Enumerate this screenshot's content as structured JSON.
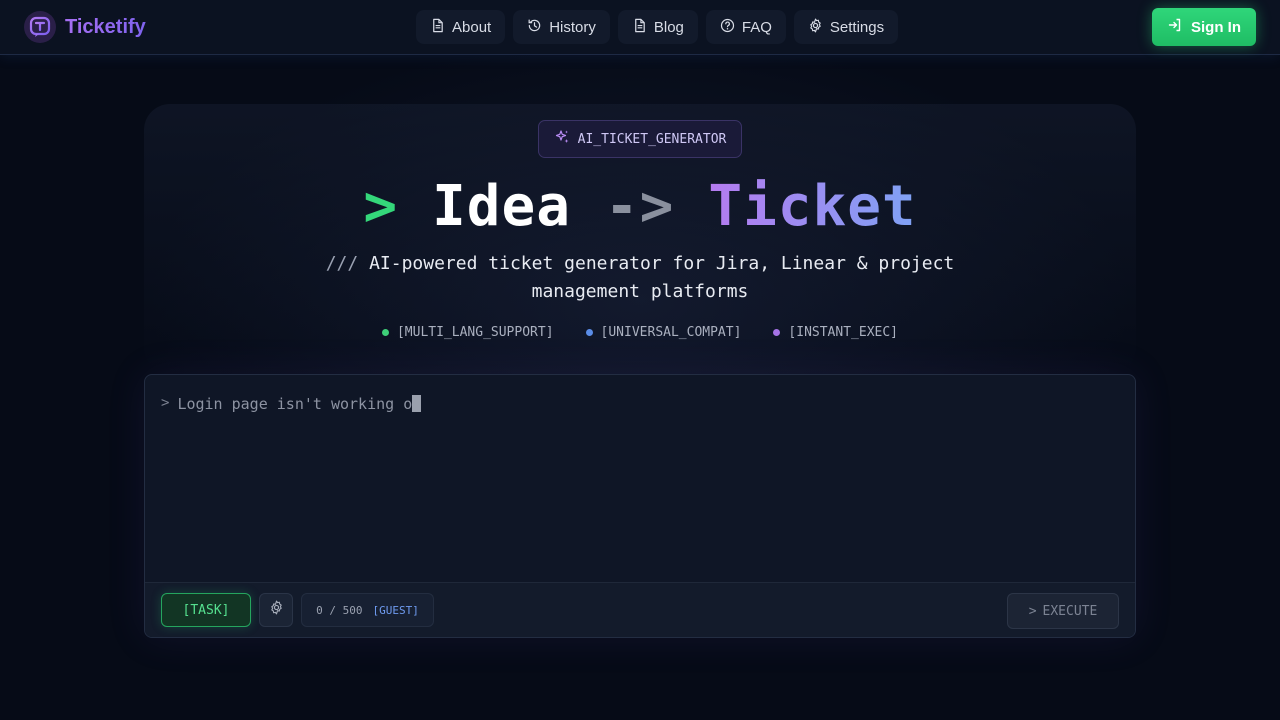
{
  "header": {
    "brand": "Ticketify",
    "nav": [
      {
        "label": "About",
        "icon": "file-icon"
      },
      {
        "label": "History",
        "icon": "history-icon"
      },
      {
        "label": "Blog",
        "icon": "file-icon"
      },
      {
        "label": "FAQ",
        "icon": "help-circle-icon"
      },
      {
        "label": "Settings",
        "icon": "gear-icon"
      }
    ],
    "signin_label": "Sign In"
  },
  "hero": {
    "badge": "AI_TICKET_GENERATOR",
    "title_prompt": ">",
    "title_word1": "Idea",
    "title_arrow": "->",
    "title_word2": "Ticket",
    "subtitle_prefix": "///",
    "subtitle_line1": "AI-powered ticket generator for Jira, Linear & project",
    "subtitle_line2": "management platforms",
    "features": [
      {
        "label": "[MULTI_LANG_SUPPORT]",
        "color": "#3ecf78"
      },
      {
        "label": "[UNIVERSAL_COMPAT]",
        "color": "#5b8de8"
      },
      {
        "label": "[INSTANT_EXEC]",
        "color": "#a573e6"
      }
    ]
  },
  "input": {
    "prompt_symbol": ">",
    "value": "Login page isn't working o"
  },
  "toolbar": {
    "task_label": "[TASK]",
    "counter": "0 / 500",
    "plan_label": "[GUEST]",
    "execute_prefix": ">",
    "execute_label": "EXECUTE"
  },
  "colors": {
    "background": "#060b17",
    "accent_green": "#2fd67a",
    "brand_purple": "#9b6ef3"
  }
}
